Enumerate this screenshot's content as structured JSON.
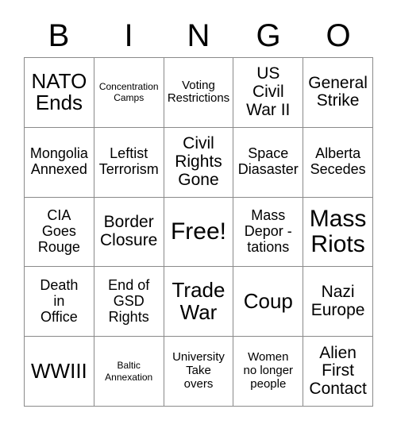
{
  "card": {
    "title": "BINGO",
    "header_letters": [
      "B",
      "I",
      "N",
      "G",
      "O"
    ],
    "grid_size": "5x5",
    "free_space_label": "Free!",
    "colors": {
      "text": "#000000",
      "background": "#ffffff",
      "grid_line": "#8a8a8a"
    },
    "rows": [
      {
        "cells": [
          {
            "text": "NATO\nEnds",
            "size": "xl"
          },
          {
            "text": "Concentration\nCamps",
            "size": "xs"
          },
          {
            "text": "Voting\nRestrictions",
            "size": "sm"
          },
          {
            "text": "US\nCivil\nWar II",
            "size": "lg"
          },
          {
            "text": "General\nStrike",
            "size": "lg"
          }
        ]
      },
      {
        "cells": [
          {
            "text": "Mongolia\nAnnexed",
            "size": "md"
          },
          {
            "text": "Leftist\nTerrorism",
            "size": "md"
          },
          {
            "text": "Civil\nRights\nGone",
            "size": "lg"
          },
          {
            "text": "Space\nDiasaster",
            "size": "md"
          },
          {
            "text": "Alberta\nSecedes",
            "size": "md"
          }
        ]
      },
      {
        "cells": [
          {
            "text": "CIA\nGoes\nRouge",
            "size": "md"
          },
          {
            "text": "Border\nClosure",
            "size": "lg"
          },
          {
            "text": "Free!",
            "size": "xxl"
          },
          {
            "text": "Mass\nDepor -\ntations",
            "size": "md"
          },
          {
            "text": "Mass\nRiots",
            "size": "xxl"
          }
        ]
      },
      {
        "cells": [
          {
            "text": "Death\nin\nOffice",
            "size": "md"
          },
          {
            "text": "End of\nGSD\nRights",
            "size": "md"
          },
          {
            "text": "Trade\nWar",
            "size": "xl"
          },
          {
            "text": "Coup",
            "size": "xl"
          },
          {
            "text": "Nazi\nEurope",
            "size": "lg"
          }
        ]
      },
      {
        "cells": [
          {
            "text": "WWIII",
            "size": "xl"
          },
          {
            "text": "Baltic\nAnnexation",
            "size": "xs"
          },
          {
            "text": "University\nTake\novers",
            "size": "sm"
          },
          {
            "text": "Women\nno longer\npeople",
            "size": "sm"
          },
          {
            "text": "Alien\nFirst\nContact",
            "size": "lg"
          }
        ]
      }
    ]
  }
}
